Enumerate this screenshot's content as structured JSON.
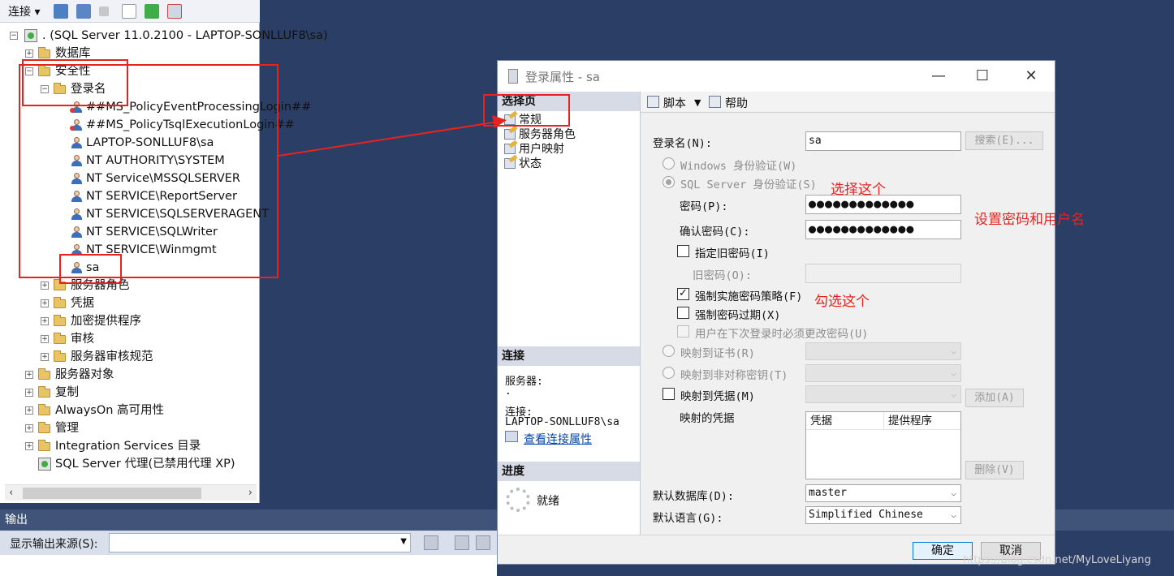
{
  "explorer": {
    "connect_label": "连接",
    "server_node": ". (SQL Server 11.0.2100 - LAPTOP-SONLLUF8\\sa)",
    "databases": "数据库",
    "security": "安全性",
    "logins": "登录名",
    "login_items": [
      "##MS_PolicyEventProcessingLogin##",
      "##MS_PolicyTsqlExecutionLogin##",
      "LAPTOP-SONLLUF8\\sa",
      "NT AUTHORITY\\SYSTEM",
      "NT Service\\MSSQLSERVER",
      "NT SERVICE\\ReportServer",
      "NT SERVICE\\SQLSERVERAGENT",
      "NT SERVICE\\SQLWriter",
      "NT SERVICE\\Winmgmt",
      "sa"
    ],
    "security_children": [
      "服务器角色",
      "凭据",
      "加密提供程序",
      "审核",
      "服务器审核规范"
    ],
    "top_nodes": [
      "服务器对象",
      "复制",
      "AlwaysOn 高可用性",
      "管理",
      "Integration Services 目录"
    ],
    "agent": "SQL Server 代理(已禁用代理 XP)"
  },
  "output": {
    "title": "输出",
    "source_label": "显示输出来源(S):",
    "source_value": ""
  },
  "dialog": {
    "title": "登录属性 - sa",
    "select_page_header": "选择页",
    "pages": [
      "常规",
      "服务器角色",
      "用户映射",
      "状态"
    ],
    "connection_header": "连接",
    "server_label": "服务器:",
    "server_value": ".",
    "connection_label": "连接:",
    "connection_value": "LAPTOP-SONLLUF8\\sa",
    "view_conn_props": "查看连接属性",
    "progress_header": "进度",
    "progress_status": "就绪",
    "toolbar": {
      "script": "脚本",
      "help": "帮助"
    },
    "form": {
      "login_name_label": "登录名(N):",
      "login_name_value": "sa",
      "search_button": "搜索(E)...",
      "windows_auth": "Windows 身份验证(W)",
      "sql_auth": "SQL Server 身份验证(S)",
      "password_label": "密码(P):",
      "password_value": "●●●●●●●●●●●●●",
      "confirm_label": "确认密码(C):",
      "confirm_value": "●●●●●●●●●●●●●",
      "old_pwd_check": "指定旧密码(I)",
      "old_pwd_label": "旧密码(O):",
      "enforce_policy": "强制实施密码策略(F)",
      "enforce_expiration": "强制密码过期(X)",
      "must_change": "用户在下次登录时必须更改密码(U)",
      "map_cert": "映射到证书(R)",
      "map_asym": "映射到非对称密钥(T)",
      "map_cred": "映射到凭据(M)",
      "add_button": "添加(A)",
      "mapped_creds": "映射的凭据",
      "cred_col": "凭据",
      "provider_col": "提供程序",
      "remove_button": "删除(V)",
      "default_db_label": "默认数据库(D):",
      "default_db_value": "master",
      "default_lang_label": "默认语言(G):",
      "default_lang_value": "Simplified Chinese"
    },
    "ok": "确定",
    "cancel": "取消"
  },
  "annotations": {
    "select_this": "选择这个",
    "set_pwd_user": "设置密码和用户名",
    "check_this": "勾选这个"
  },
  "watermark": "https://blog.csdn.net/MyLoveLiyang",
  "colors": {
    "annotation": "#e8231f",
    "ide_background": "#2b3f66"
  }
}
